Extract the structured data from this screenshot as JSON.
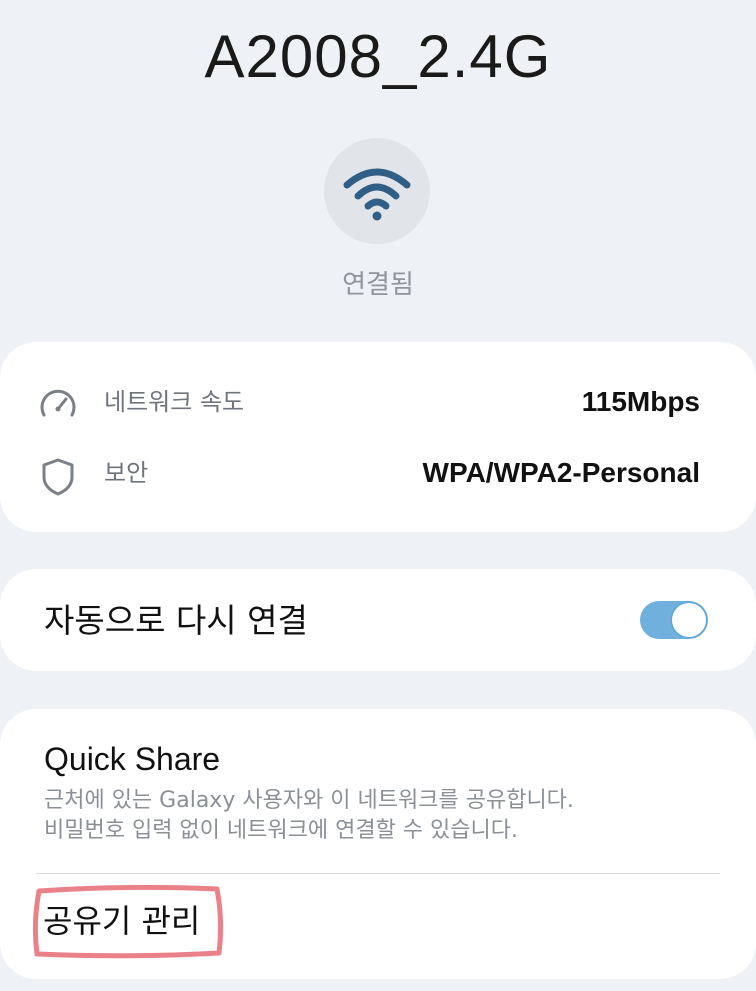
{
  "network": {
    "ssid": "A2008_2.4G",
    "status": "연결됨"
  },
  "info": {
    "speed": {
      "label": "네트워크 속도",
      "value": "115Mbps",
      "icon": "speedometer-icon"
    },
    "security": {
      "label": "보안",
      "value": "WPA/WPA2-Personal",
      "icon": "shield-icon"
    }
  },
  "auto_reconnect": {
    "label": "자동으로 다시 연결",
    "enabled": true
  },
  "quick_share": {
    "title": "Quick Share",
    "description_line1": "근처에 있는 Galaxy 사용자와 이 네트워크를 공유합니다.",
    "description_line2": "비밀번호 입력 없이 네트워크에 연결할 수 있습니다."
  },
  "router_manage": {
    "label": "공유기 관리"
  },
  "colors": {
    "background": "#eef1f5",
    "card": "#ffffff",
    "wifi_icon": "#2f5f86",
    "toggle_on": "#6fb0dc",
    "highlight": "#e8737c"
  }
}
